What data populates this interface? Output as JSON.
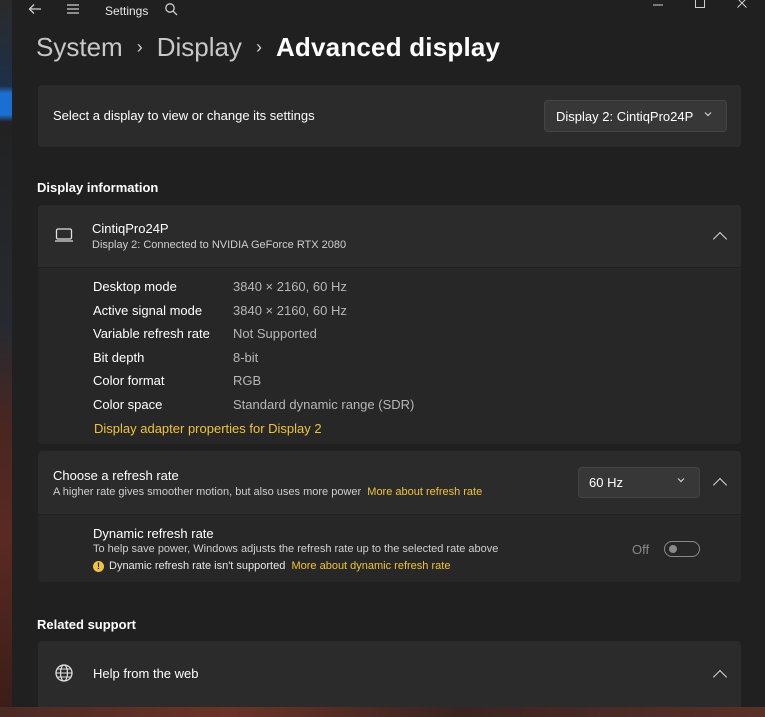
{
  "window": {
    "title": "Settings",
    "back_icon": "back-arrow-icon",
    "menu_icon": "hamburger-menu-icon",
    "search_icon": "search-icon",
    "controls": [
      "minimize",
      "maximize",
      "close"
    ]
  },
  "breadcrumb": {
    "items": [
      "System",
      "Display",
      "Advanced display"
    ]
  },
  "display_select": {
    "label": "Select a display to view or change its settings",
    "value": "Display 2: CintiqPro24P"
  },
  "display_info": {
    "heading": "Display information",
    "name": "CintiqPro24P",
    "connection": "Display 2: Connected to NVIDIA GeForce RTX 2080",
    "rows": [
      {
        "label": "Desktop mode",
        "value": "3840 × 2160, 60 Hz"
      },
      {
        "label": "Active signal mode",
        "value": "3840 × 2160, 60 Hz"
      },
      {
        "label": "Variable refresh rate",
        "value": "Not Supported"
      },
      {
        "label": "Bit depth",
        "value": "8-bit"
      },
      {
        "label": "Color format",
        "value": "RGB"
      },
      {
        "label": "Color space",
        "value": "Standard dynamic range (SDR)"
      }
    ],
    "adapter_link": "Display adapter properties for Display 2"
  },
  "refresh": {
    "title": "Choose a refresh rate",
    "desc": "A higher rate gives smoother motion, but also uses more power",
    "more_link": "More about refresh rate",
    "value": "60 Hz",
    "dynamic": {
      "title": "Dynamic refresh rate",
      "desc": "To help save power, Windows adjusts the refresh rate up to the selected rate above",
      "warning": "Dynamic refresh rate isn't supported",
      "more_link": "More about dynamic refresh rate",
      "toggle_label": "Off",
      "toggle_on": false
    }
  },
  "related": {
    "heading": "Related support",
    "help_item": "Help from the web"
  },
  "colors": {
    "accent_link": "#f0c43a",
    "window_bg": "#202020",
    "card_bg": "#2b2b2b"
  }
}
